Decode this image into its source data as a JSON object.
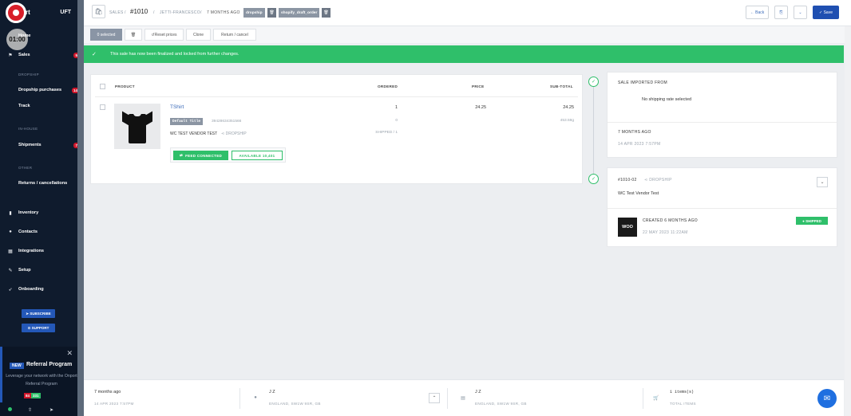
{
  "sidebar": {
    "brand_text": "rt",
    "brand_code": "UFT",
    "timer": "01:00",
    "nav": [
      {
        "label": "Home",
        "icon": "home-icon"
      },
      {
        "label": "Sales",
        "icon": "flag-icon",
        "badge": "5"
      },
      {
        "label": "Dropship purchases",
        "badge": "14"
      },
      {
        "label": "Track"
      },
      {
        "label": "Shipments",
        "badge": "7"
      },
      {
        "label": "Returns / cancellations"
      },
      {
        "label": "Inventory",
        "icon": "bookmark-icon"
      },
      {
        "label": "Contacts",
        "icon": "user-icon"
      },
      {
        "label": "Integrations",
        "icon": "grid-icon"
      },
      {
        "label": "Setup",
        "icon": "wrench-icon"
      },
      {
        "label": "Onboarding",
        "icon": "rocket-icon"
      }
    ],
    "sections": [
      "DROPSHIP",
      "IN-HOUSE",
      "OTHER"
    ],
    "subscribe_label": "SUBSCRIBE",
    "support_label": "SUPPORT",
    "referral": {
      "new_label": "NEW",
      "title": "Referral Program",
      "desc": "Leverage your network with the Onport Referral Program"
    },
    "chips": [
      "84",
      "331"
    ]
  },
  "header": {
    "crumb_sales": "SALES",
    "order_number": "#1010",
    "customer": "JETTI-FRANCESCO",
    "age": "7 MONTHS AGO",
    "tags": [
      "dropship",
      "shopify_draft_order"
    ],
    "back_label": "Back",
    "save_label": "Save"
  },
  "toolbar": {
    "selected": "0 selected",
    "reset_prices": "Reset prices",
    "clone": "Clone",
    "return_cancel": "Return / cancel"
  },
  "alert": {
    "message": "This sale has now been finalized and locked from further changes."
  },
  "table": {
    "headers": {
      "product": "PRODUCT",
      "ordered": "ORDERED",
      "price": "PRICE",
      "subtotal": "SUB-TOTAL"
    },
    "row": {
      "name": "TShirt",
      "variant": "Default Title",
      "sku": "39428634351566",
      "vendor": "WC TEST VENDOR TEST",
      "fulfillment": "DROPSHIP",
      "ordered": "1",
      "ordered_sub": "0",
      "shipped_label": "SHIPPED",
      "shipped_count": "1",
      "price": "24.25",
      "subtotal": "24.25",
      "weight": "453.59g",
      "feed_label": "FEED CONNECTED",
      "available_label": "AVAILABLE 10,401"
    }
  },
  "timeline": {
    "import": {
      "title": "SALE IMPORTED FROM",
      "shipping": "No shipping rate selected",
      "age": "7 MONTHS AGO",
      "date": "14 APR 2023 7:57PM"
    },
    "dropship": {
      "code": "#1010-02",
      "type": "DROPSHIP",
      "vendor": "WC Test Vendor Test",
      "created": "CREATED 6 MONTHS AGO",
      "date": "22 MAY 2023 11:22AM",
      "status": "SHIPPED",
      "logo_text": "WOO"
    }
  },
  "footer": {
    "age": "7 months ago",
    "date": "14 APR 2023 7:57PM",
    "billing_name": "J Z",
    "billing_addr": "ENGLAND, SW1W 9SR, GB",
    "shipping_name": "J Z",
    "shipping_addr": "ENGLAND, SW1W 9SR, GB",
    "items": "1 items(s)",
    "items_label": "TOTAL ITEMS"
  },
  "colors": {
    "accent": "#1f4fb1",
    "success": "#2fbf6a",
    "sidebar": "#0f1b2d",
    "danger": "#d0162a"
  }
}
